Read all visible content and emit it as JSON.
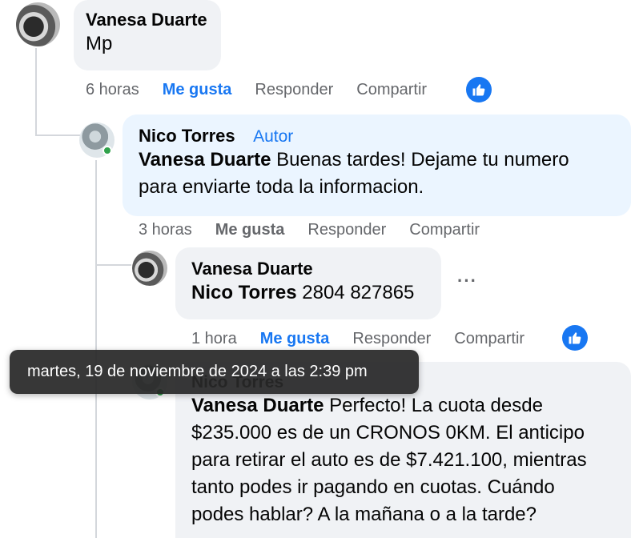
{
  "comments": [
    {
      "author": "Vanesa Duarte",
      "text": "Mp",
      "time": "6 horas",
      "like": "Me gusta",
      "reply": "Responder",
      "share": "Compartir"
    },
    {
      "author": "Nico Torres",
      "badge": "Autor",
      "mention": "Vanesa Duarte",
      "text_line1": " Buenas tardes! Dejame tu numero",
      "text_line2": "para enviarte toda la informacion.",
      "time": "3 horas",
      "like": "Me gusta",
      "reply": "Responder",
      "share": "Compartir"
    },
    {
      "author": "Vanesa Duarte",
      "mention": "Nico Torres",
      "text": " 2804 827865",
      "time": "1 hora",
      "like": "Me gusta",
      "reply": "Responder",
      "share": "Compartir",
      "more": "···"
    },
    {
      "author": "Nico Torres",
      "mention": "Vanesa Duarte",
      "text_line1": " Perfecto! La cuota desde",
      "text_line2": "$235.000 es de un CRONOS 0KM. El anticipo",
      "text_line3": "para retirar el auto es de $7.421.100, mientras",
      "text_line4": "tanto podes ir pagando en cuotas. Cuándo",
      "text_line5": "podes hablar? A la mañana o a la tarde?"
    }
  ],
  "tooltip": "martes, 19 de noviembre de 2024 a las 2:39 pm",
  "colors": {
    "accent": "#1877f2",
    "secondary_text": "#65676b",
    "bubble_grey": "#f0f2f5",
    "bubble_blue": "#ebf5ff"
  }
}
